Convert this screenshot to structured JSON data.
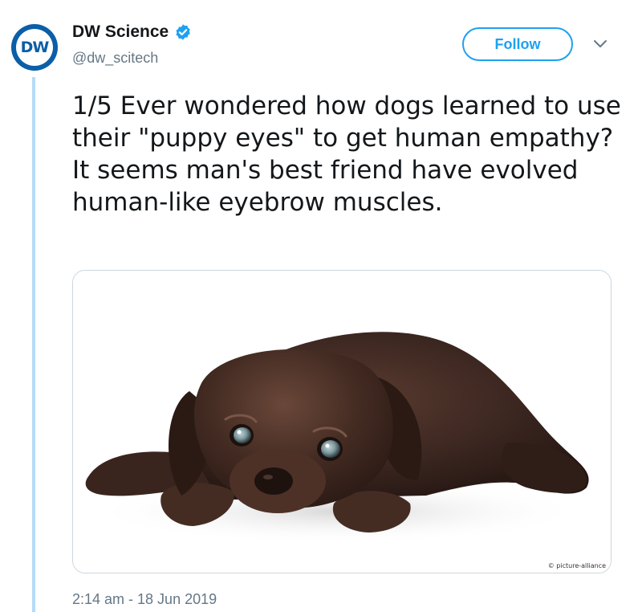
{
  "author": {
    "display_name": "DW Science",
    "handle": "@dw_scitech",
    "avatar_text": "DW",
    "verified": true
  },
  "actions": {
    "follow_label": "Follow"
  },
  "tweet": {
    "text": "1/5 Ever wondered how dogs learned to use their \"puppy eyes\" to get human empathy? It seems man's best friend have evolved human-like eyebrow muscles.",
    "timestamp": "2:14 am - 18 Jun 2019"
  },
  "media": {
    "credit": "© picture-alliance"
  },
  "colors": {
    "brand_blue": "#1da1f2",
    "avatar_blue": "#0a5fa8",
    "muted_text": "#657786",
    "thread_line": "#b6dbf6"
  },
  "icons": {
    "verified": "verified-badge-icon",
    "menu": "chevron-down-icon"
  }
}
